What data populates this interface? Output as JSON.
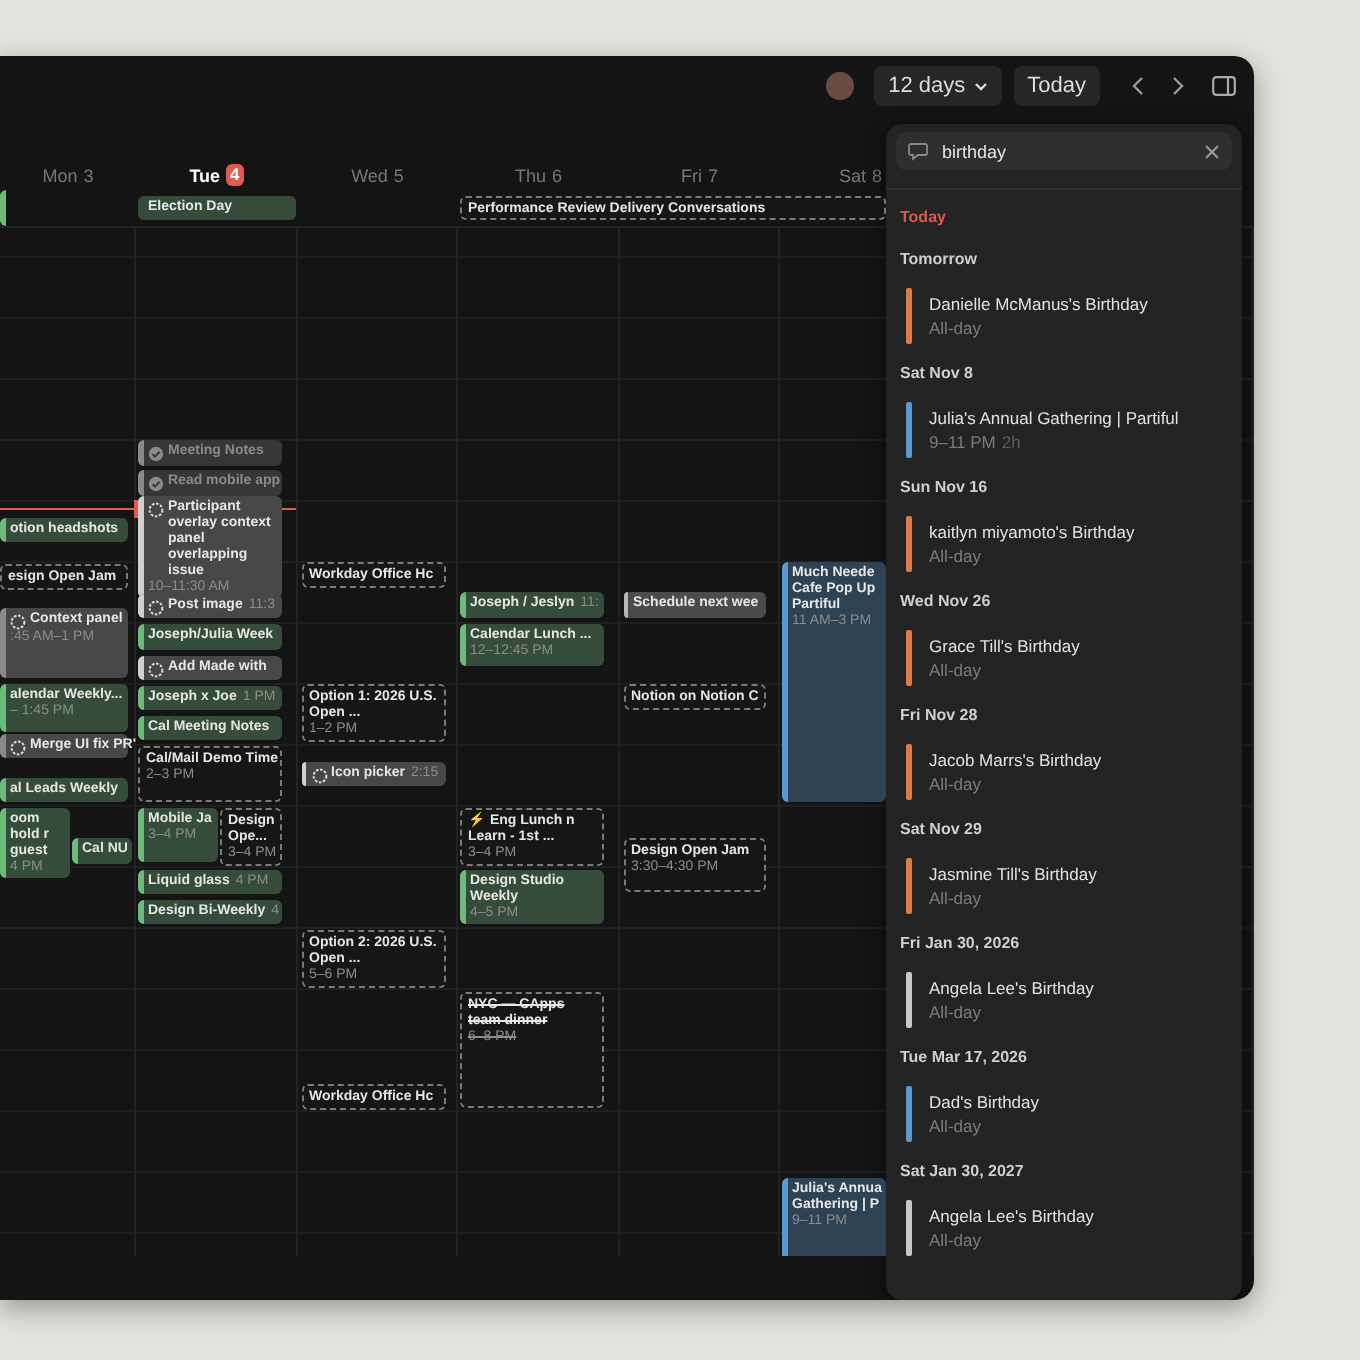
{
  "toolbar": {
    "range": "12 days",
    "today_button": "Today"
  },
  "days": [
    {
      "name": "Mon",
      "date": "3",
      "today": false,
      "events": [
        {
          "title": "otion headshots",
          "kind": "event",
          "color": "#6dbb7b"
        },
        {
          "title": "esign Open Jam",
          "kind": "tentative"
        },
        {
          "title": "Context panel",
          "time": ":45 AM–1 PM",
          "kind": "task",
          "color": "#8a8a8a"
        },
        {
          "title": "alendar Weekly...",
          "time": "– 1:45 PM",
          "kind": "event",
          "color": "#6dbb7b"
        },
        {
          "title": "Merge UI fix PR'",
          "kind": "task",
          "color": "#8a8a8a"
        },
        {
          "title": "al Leads Weekly",
          "kind": "event",
          "color": "#6dbb7b"
        },
        {
          "title": "oom hold r guest",
          "time": "4 PM",
          "kind": "event",
          "color": "#6dbb7b"
        },
        {
          "title": "Cal NU",
          "kind": "event",
          "color": "#6dbb7b"
        }
      ]
    },
    {
      "name": "Tue",
      "date": "4",
      "today": true,
      "events": [
        {
          "title": "Meeting Notes",
          "kind": "done",
          "color": "#8a8a8a"
        },
        {
          "title": "Read mobile app",
          "kind": "done",
          "color": "#8a8a8a"
        },
        {
          "title": "Participant overlay context panel overlapping issue",
          "time": "10–11:30 AM",
          "kind": "task",
          "color": "#d0d0d0"
        },
        {
          "title": "Post image",
          "time": "11:3",
          "kind": "task",
          "color": "#d0d0d0"
        },
        {
          "title": "Joseph/Julia Week",
          "kind": "event",
          "color": "#6dbb7b"
        },
        {
          "title": "Add Made with",
          "kind": "task",
          "color": "#d0d0d0"
        },
        {
          "title": "Joseph x Joe",
          "time": "1 PM",
          "kind": "event",
          "color": "#6dbb7b"
        },
        {
          "title": "Cal Meeting Notes",
          "kind": "event",
          "color": "#6dbb7b"
        },
        {
          "title": "Cal/Mail Demo Time",
          "time": "2–3 PM",
          "kind": "tentative"
        },
        {
          "title": "Mobile Ja",
          "time": "3–4 PM",
          "kind": "event",
          "color": "#6dbb7b"
        },
        {
          "title": "Design Ope...",
          "time": "3–4 PM",
          "kind": "tentative"
        },
        {
          "title": "Liquid glass",
          "time": "4 PM",
          "kind": "event",
          "color": "#6dbb7b"
        },
        {
          "title": "Design Bi-Weekly",
          "time": "4",
          "kind": "event",
          "color": "#6dbb7b"
        }
      ]
    },
    {
      "name": "Wed",
      "date": "5",
      "today": false,
      "events": [
        {
          "title": "Workday Office Hc",
          "kind": "tentative"
        },
        {
          "title": "Option 1: 2026 U.S. Open ...",
          "time": "1–2 PM",
          "kind": "tentative"
        },
        {
          "title": "Icon picker",
          "time": "2:15",
          "kind": "task",
          "color": "#d0d0d0"
        },
        {
          "title": "Option 2: 2026 U.S. Open ...",
          "time": "5–6 PM",
          "kind": "tentative"
        },
        {
          "title": "Workday Office Hc",
          "kind": "tentative"
        }
      ]
    },
    {
      "name": "Thu",
      "date": "6",
      "today": false,
      "events": [
        {
          "title": "Joseph / Jeslyn",
          "time": "11:",
          "kind": "event",
          "color": "#6dbb7b"
        },
        {
          "title": "Calendar Lunch ...",
          "time": "12–12:45 PM",
          "kind": "event",
          "color": "#6dbb7b"
        },
        {
          "title": "⚡ Eng Lunch n Learn - 1st ...",
          "time": "3–4 PM",
          "kind": "tentative"
        },
        {
          "title": "Design Studio Weekly",
          "time": "4–5 PM",
          "kind": "event",
          "color": "#6dbb7b"
        },
        {
          "title": "NYC — CApps team dinner",
          "time": "6–8 PM",
          "kind": "declined"
        }
      ]
    },
    {
      "name": "Fri",
      "date": "7",
      "today": false,
      "events": [
        {
          "title": "Schedule next wee",
          "kind": "event",
          "color": "#b8b8b8"
        },
        {
          "title": "Notion on Notion C",
          "kind": "tentative"
        },
        {
          "title": "Design Open Jam",
          "time": "3:30–4:30 PM",
          "kind": "tentative"
        }
      ]
    },
    {
      "name": "Sat",
      "date": "8",
      "today": false,
      "events": [
        {
          "title": "Much Neede Cafe Pop Up Partiful",
          "time": "11 AM–3 PM",
          "kind": "event",
          "color": "#5b9bd5"
        },
        {
          "title": "Julia's Annua Gathering | P",
          "time": "9–11 PM",
          "kind": "event",
          "color": "#5b9bd5"
        }
      ]
    }
  ],
  "all_day_events": [
    {
      "title": "Election Day",
      "kind": "event",
      "color": "#6dbb7b"
    },
    {
      "title": "Performance Review Delivery Conversations",
      "kind": "tentative"
    }
  ],
  "search": {
    "query": "birthday",
    "groups": [
      {
        "heading": "Today",
        "today": true
      },
      {
        "heading": "Tomorrow",
        "today": false,
        "items": [
          {
            "title": "Danielle McManus's Birthday",
            "time": "All-day",
            "color": "#e07a45"
          }
        ]
      },
      {
        "heading": "Sat Nov 8",
        "today": false,
        "items": [
          {
            "title": "Julia's Annual Gathering | Partiful",
            "time": "9–11 PM",
            "duration": "2h",
            "color": "#5b9bd5"
          }
        ]
      },
      {
        "heading": "Sun Nov 16",
        "today": false,
        "items": [
          {
            "title": "kaitlyn miyamoto's Birthday",
            "time": "All-day",
            "color": "#e07a45"
          }
        ]
      },
      {
        "heading": "Wed Nov 26",
        "today": false,
        "items": [
          {
            "title": "Grace Till's Birthday",
            "time": "All-day",
            "color": "#e07a45"
          }
        ]
      },
      {
        "heading": "Fri Nov 28",
        "today": false,
        "items": [
          {
            "title": "Jacob Marrs's Birthday",
            "time": "All-day",
            "color": "#e07a45"
          }
        ]
      },
      {
        "heading": "Sat Nov 29",
        "today": false,
        "items": [
          {
            "title": "Jasmine Till's Birthday",
            "time": "All-day",
            "color": "#e07a45"
          }
        ]
      },
      {
        "heading": "Fri Jan 30, 2026",
        "today": false,
        "items": [
          {
            "title": "Angela Lee's Birthday",
            "time": "All-day",
            "color": "#c8c8c8"
          }
        ]
      },
      {
        "heading": "Tue Mar 17, 2026",
        "today": false,
        "items": [
          {
            "title": "Dad's Birthday",
            "time": "All-day",
            "color": "#5b9bd5"
          }
        ]
      },
      {
        "heading": "Sat Jan 30, 2027",
        "today": false,
        "items": [
          {
            "title": "Angela Lee's Birthday",
            "time": "All-day",
            "color": "#c8c8c8"
          }
        ]
      }
    ]
  }
}
